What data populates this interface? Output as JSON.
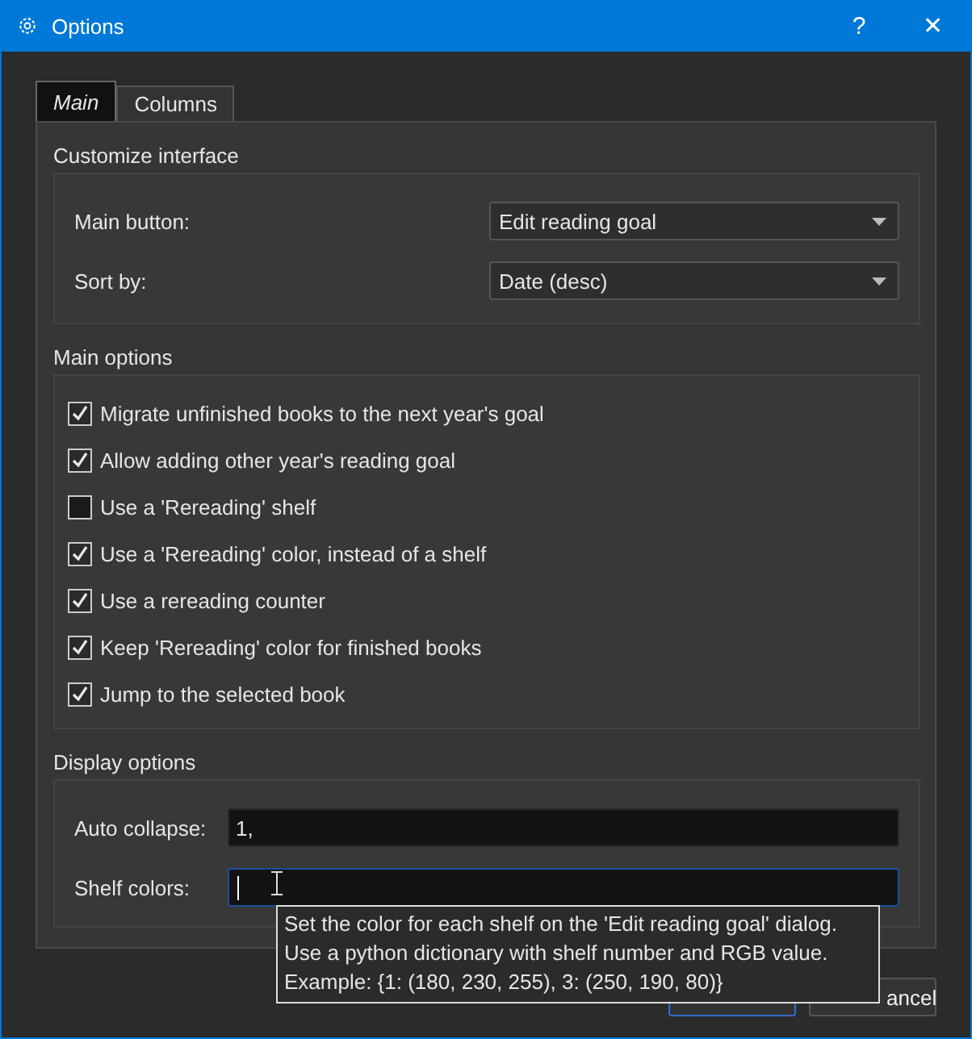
{
  "window": {
    "title": "Options",
    "help": "?",
    "close": "✕"
  },
  "tabs": [
    {
      "label": "Main",
      "selected": true
    },
    {
      "label": "Columns",
      "selected": false
    }
  ],
  "customize_interface": {
    "title": "Customize interface",
    "rows": [
      {
        "label": "Main button:",
        "value": "Edit reading goal"
      },
      {
        "label": "Sort by:",
        "value": "Date (desc)"
      }
    ]
  },
  "main_options": {
    "title": "Main options",
    "items": [
      {
        "label": "Migrate unfinished books to the next year's goal",
        "checked": true
      },
      {
        "label": "Allow adding other year's reading goal",
        "checked": true
      },
      {
        "label": "Use a 'Rereading' shelf",
        "checked": false
      },
      {
        "label": "Use a 'Rereading' color, instead of a shelf",
        "checked": true
      },
      {
        "label": "Use a rereading counter",
        "checked": true
      },
      {
        "label": "Keep 'Rereading' color for finished books",
        "checked": true
      },
      {
        "label": "Jump to the selected book",
        "checked": true
      }
    ]
  },
  "display_options": {
    "title": "Display options",
    "fields": [
      {
        "label": "Auto collapse:",
        "value": "1,",
        "focused": false
      },
      {
        "label": "Shelf colors:",
        "focused": true
      }
    ]
  },
  "tooltip": [
    "Set the color for each shelf on the 'Edit reading goal' dialog.",
    "Use a python dictionary with shelf number and RGB value.",
    "Example: {1: (180, 230, 255), 3: (250, 190, 80)}"
  ],
  "buttons": [
    {
      "label": "ancel"
    }
  ]
}
